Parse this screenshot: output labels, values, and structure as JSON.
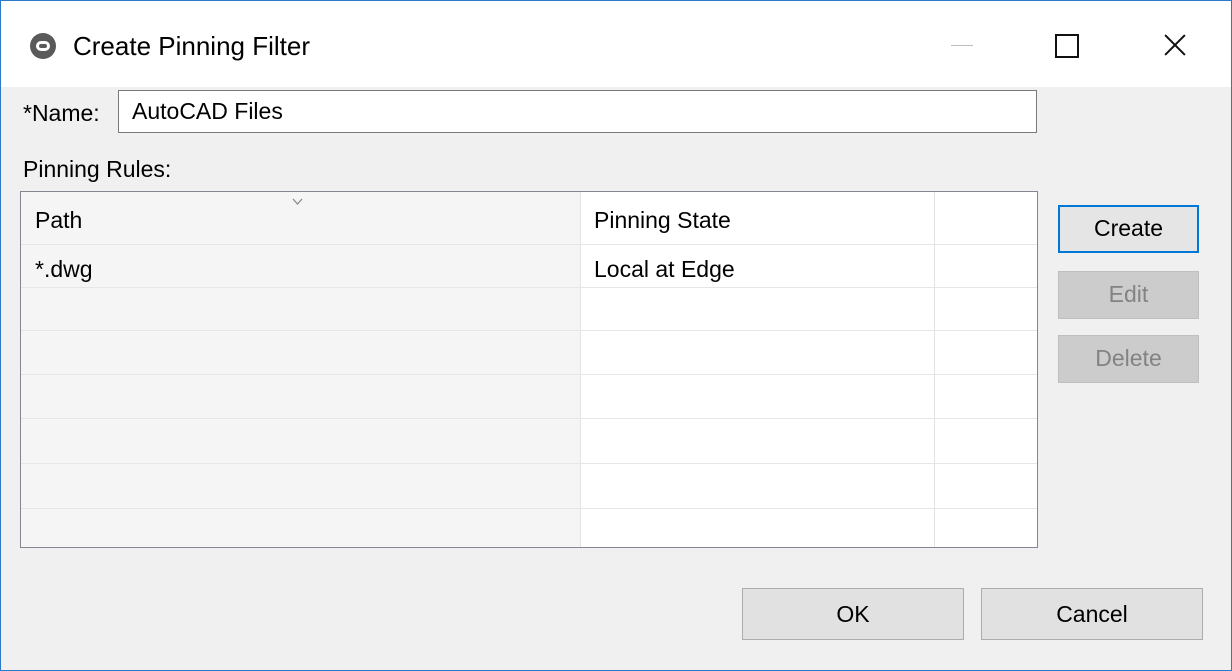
{
  "window": {
    "title": "Create Pinning Filter"
  },
  "form": {
    "name_label": "*Name:",
    "name_value": "AutoCAD Files",
    "rules_label": "Pinning Rules:"
  },
  "table": {
    "columns": [
      "Path",
      "Pinning State"
    ],
    "rows": [
      {
        "path": "*.dwg",
        "state": "Local at Edge"
      }
    ]
  },
  "side_buttons": {
    "create": "Create",
    "edit": "Edit",
    "delete": "Delete"
  },
  "footer": {
    "ok": "OK",
    "cancel": "Cancel"
  },
  "colors": {
    "window_border": "#2b79c9",
    "focus_accent": "#0078d7",
    "dialog_bg": "#f0f0f0"
  }
}
